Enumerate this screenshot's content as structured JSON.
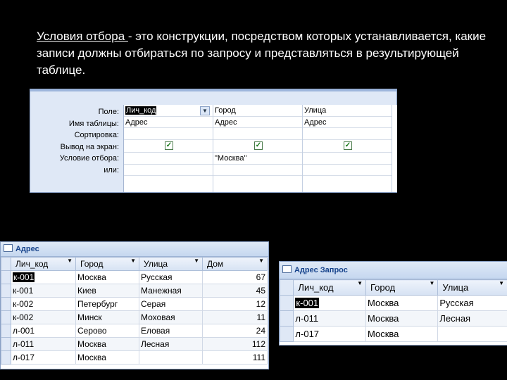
{
  "caption": {
    "underlined": "Условия отбора ",
    "rest": " - это конструкции, посредством которых устанавливается, какие записи должны отбираться по запросу и представляться в результирующей таблице."
  },
  "query_design": {
    "row_labels": [
      "Поле:",
      "Имя таблицы:",
      "Сортировка:",
      "Вывод на экран:",
      "Условие отбора:",
      "или:"
    ],
    "columns": [
      {
        "field": "Лич_код",
        "table": "Адрес",
        "sort": "",
        "show": true,
        "criteria": "",
        "or": ""
      },
      {
        "field": "Город",
        "table": "Адрес",
        "sort": "",
        "show": true,
        "criteria": "\"Москва\"",
        "or": ""
      },
      {
        "field": "Улица",
        "table": "Адрес",
        "sort": "",
        "show": true,
        "criteria": "",
        "or": ""
      }
    ],
    "dropdown_icon": "chevron-down-icon",
    "check_glyph": "✓"
  },
  "table_adres": {
    "title": "Адрес",
    "columns": [
      "Лич_код",
      "Город",
      "Улица",
      "Дом"
    ],
    "rows": [
      [
        "к-001",
        "Москва",
        "Русская",
        "67"
      ],
      [
        "к-001",
        "Киев",
        "Манежная",
        "45"
      ],
      [
        "к-002",
        "Петербург",
        "Серая",
        "12"
      ],
      [
        "к-002",
        "Минск",
        "Моховая",
        "11"
      ],
      [
        "л-001",
        "Серово",
        "Еловая",
        "24"
      ],
      [
        "л-011",
        "Москва",
        "Лесная",
        "112"
      ],
      [
        "л-017",
        "Москва",
        "",
        "111"
      ]
    ]
  },
  "table_query": {
    "title": "Адрес Запрос",
    "columns": [
      "Лич_код",
      "Город",
      "Улица"
    ],
    "rows": [
      [
        "к-001",
        "Москва",
        "Русская"
      ],
      [
        "л-011",
        "Москва",
        "Лесная"
      ],
      [
        "л-017",
        "Москва",
        ""
      ]
    ]
  },
  "colors": {
    "background": "#000000",
    "grid_bg": "#dfe8f6",
    "header_text": "#15428b"
  }
}
